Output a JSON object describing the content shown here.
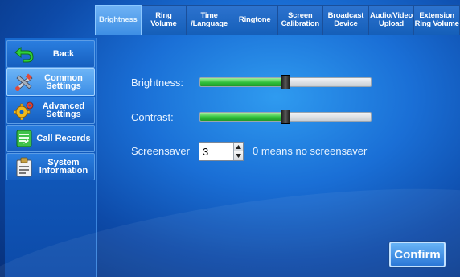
{
  "tabs": [
    {
      "label": "Brightness",
      "active": true
    },
    {
      "label": "Ring\nVolume",
      "active": false
    },
    {
      "label": "Time\n/Language",
      "active": false
    },
    {
      "label": "Ringtone",
      "active": false
    },
    {
      "label": "Screen\nCalibration",
      "active": false
    },
    {
      "label": "Broadcast\nDevice",
      "active": false
    },
    {
      "label": "Audio/Video\nUpload",
      "active": false
    },
    {
      "label": "Extension\nRing Volume",
      "active": false
    }
  ],
  "sidebar": {
    "items": [
      {
        "label": "Back",
        "icon": "back-arrow-icon"
      },
      {
        "label": "Common\nSettings",
        "icon": "tools-icon",
        "active": true
      },
      {
        "label": "Advanced\nSettings",
        "icon": "gears-icon"
      },
      {
        "label": "Call Records",
        "icon": "call-records-icon"
      },
      {
        "label": "System\nInformation",
        "icon": "system-info-icon"
      }
    ]
  },
  "main": {
    "brightness_label": "Brightness:",
    "brightness_level": 0.5,
    "contrast_label": "Contrast:",
    "contrast_level": 0.5,
    "screensaver_label": "Screensaver",
    "screensaver_value": "3",
    "screensaver_hint": "0 means no screensaver",
    "confirm_label": "Confirm"
  },
  "colors": {
    "background": "#1a6fd6",
    "slider_fill": "#2fbf3a",
    "accent": "#3e8fe4"
  }
}
